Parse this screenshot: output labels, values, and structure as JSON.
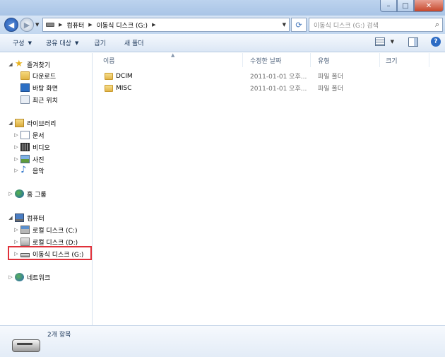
{
  "window": {
    "minimize": "–",
    "maximize": "□",
    "close": "✕"
  },
  "address": {
    "segments": [
      "컴퓨터",
      "이동식 디스크 (G:)"
    ],
    "search_placeholder": "이동식 디스크 (G:) 검색"
  },
  "toolbar": {
    "organize": "구성",
    "share": "공유 대상",
    "burn": "굽기",
    "new_folder": "새 폴더",
    "help": "?"
  },
  "nav": {
    "favorites": "즐겨찾기",
    "downloads": "다운로드",
    "desktop": "바탕 화면",
    "recent": "최근 위치",
    "libraries": "라이브러리",
    "documents": "문서",
    "videos": "비디오",
    "pictures": "사진",
    "music": "음악",
    "homegroup": "홈 그룹",
    "computer": "컴퓨터",
    "local_c": "로컬 디스크 (C:)",
    "local_d": "로컬 디스크 (D:)",
    "removable_g": "이동식 디스크 (G:)",
    "network": "네트워크"
  },
  "columns": {
    "name": "이름",
    "date": "수정한 날짜",
    "type": "유형",
    "size": "크기"
  },
  "files": [
    {
      "name": "DCIM",
      "date": "2011-01-01 오후...",
      "type": "파일 폴더"
    },
    {
      "name": "MISC",
      "date": "2011-01-01 오후...",
      "type": "파일 폴더"
    }
  ],
  "details": {
    "count": "2개 항목"
  }
}
